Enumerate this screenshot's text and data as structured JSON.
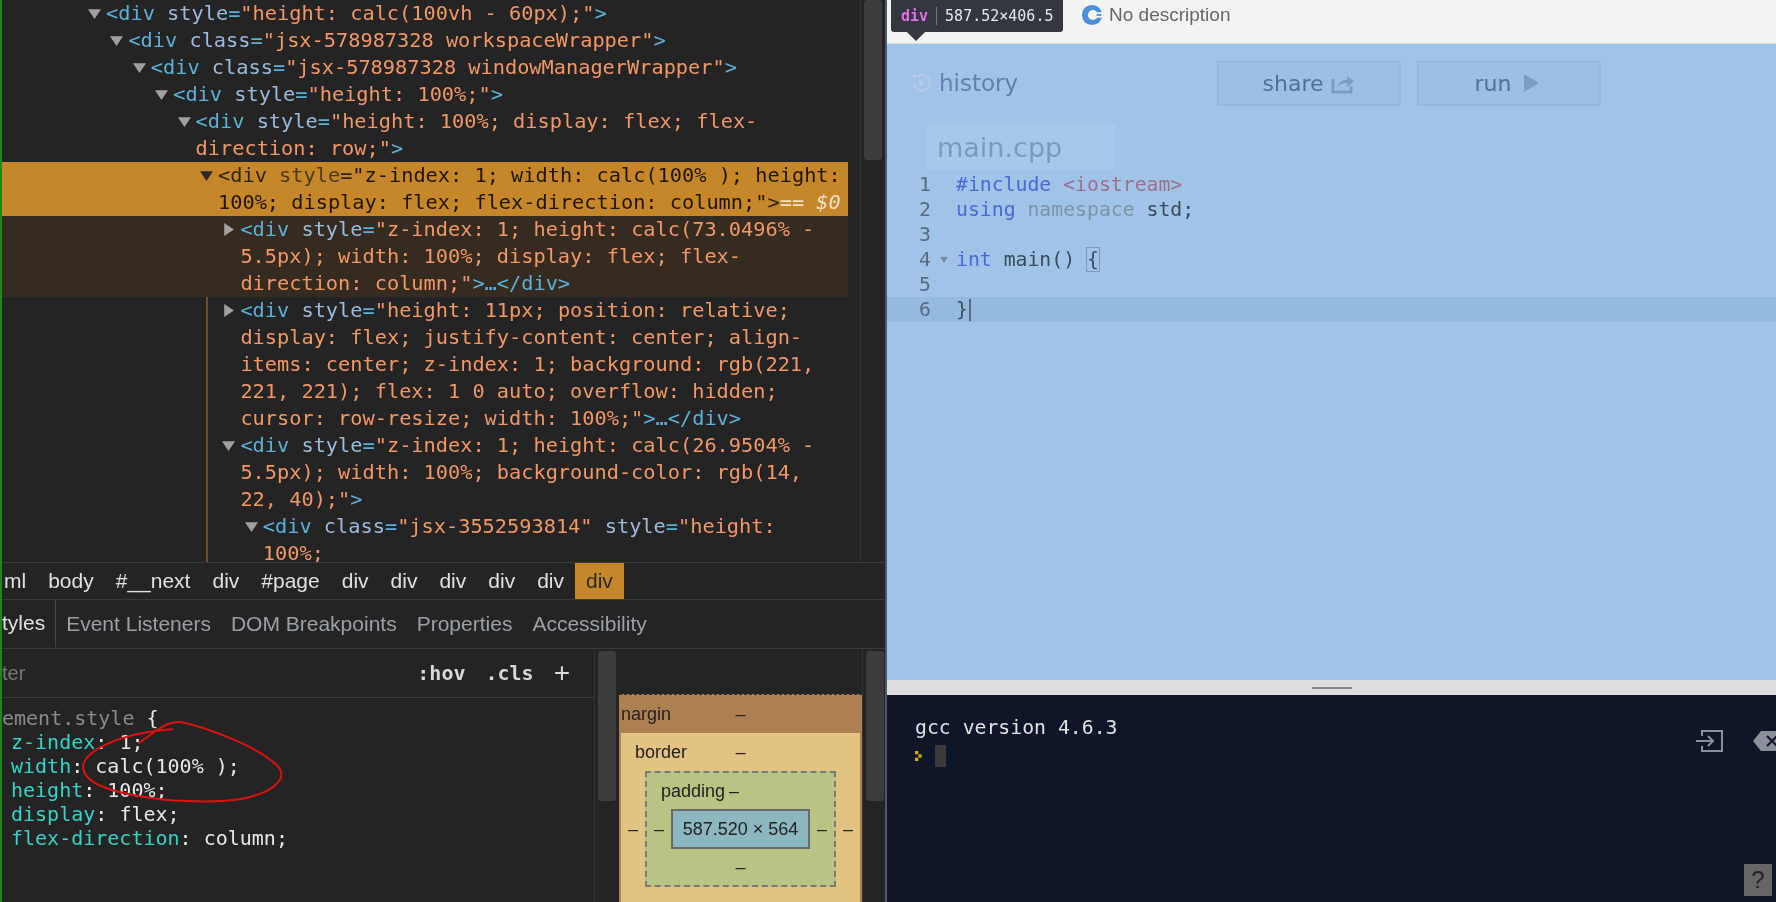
{
  "dom_tree": {
    "selected_suffix": "== $0",
    "nodes": [
      {
        "markup": "<div style=\"height: calc(100vh - 60px);\">",
        "expanded": true,
        "selected": false,
        "hovered": false,
        "children": [
          {
            "markup": "<div class=\"jsx-578987328 workspaceWrapper\">",
            "expanded": true,
            "selected": false,
            "hovered": false,
            "children": [
              {
                "markup": "<div class=\"jsx-578987328 windowManagerWrapper\">",
                "expanded": true,
                "selected": false,
                "hovered": false,
                "children": [
                  {
                    "markup": "<div style=\"height: 100%;\">",
                    "expanded": true,
                    "selected": false,
                    "hovered": false,
                    "children": [
                      {
                        "markup": "<div style=\"height: 100%; display: flex; flex-direction: row;\">",
                        "expanded": true,
                        "selected": false,
                        "hovered": false,
                        "children": [
                          {
                            "markup": "<div style=\"z-index: 1; width: calc(100% ); height: 100%; display: flex; flex-direction: column;\">",
                            "expanded": true,
                            "selected": true,
                            "hovered": false,
                            "children": [
                              {
                                "markup": "<div style=\"z-index: 1; height: calc(73.0496% - 5.5px); width: 100%; display: flex; flex-direction: column;\">…</div>",
                                "expanded": false,
                                "selected": false,
                                "hovered": true
                              },
                              {
                                "markup": "<div style=\"height: 11px; position: relative; display: flex; justify-content: center; align-items: center; z-index: 1; background: rgb(221, 221, 221); flex: 1 0 auto; overflow: hidden; cursor: row-resize; width: 100%;\">…</div>",
                                "expanded": false,
                                "selected": false,
                                "hovered": false
                              },
                              {
                                "markup": "<div style=\"z-index: 1; height: calc(26.9504% - 5.5px); width: 100%; background-color: rgb(14, 22, 40);\">",
                                "expanded": true,
                                "selected": false,
                                "hovered": false,
                                "children": [
                                  {
                                    "markup": "<div class=\"jsx-3552593814\" style=\"height: 100%;",
                                    "expanded": true,
                                    "selected": false,
                                    "hovered": false
                                  }
                                ]
                              }
                            ]
                          }
                        ]
                      }
                    ]
                  }
                ]
              }
            ]
          }
        ]
      }
    ]
  },
  "breadcrumbs": [
    {
      "label": "ml",
      "selected": false
    },
    {
      "label": "body",
      "selected": false
    },
    {
      "label": "#__next",
      "selected": false
    },
    {
      "label": "div",
      "selected": false
    },
    {
      "label": "#page",
      "selected": false
    },
    {
      "label": "div",
      "selected": false
    },
    {
      "label": "div",
      "selected": false
    },
    {
      "label": "div",
      "selected": false
    },
    {
      "label": "div",
      "selected": false
    },
    {
      "label": "div",
      "selected": false
    },
    {
      "label": "div",
      "selected": true
    }
  ],
  "panel_tabs": [
    {
      "label": "tyles",
      "selected": true
    },
    {
      "label": "Event Listeners",
      "selected": false
    },
    {
      "label": "DOM Breakpoints",
      "selected": false
    },
    {
      "label": "Properties",
      "selected": false
    },
    {
      "label": "Accessibility",
      "selected": false
    }
  ],
  "styles_filter": {
    "placeholder": "ter",
    "buttons": [
      ":hov",
      ".cls",
      "+"
    ]
  },
  "style_rule": {
    "selector": "ement.style {",
    "declarations": [
      "z-index: 1;",
      "width: calc(100% );",
      "height: 100%;",
      "display: flex;",
      "flex-direction: column;"
    ]
  },
  "box_model": {
    "margin": {
      "label": "nargin",
      "top": "–"
    },
    "border": {
      "label": "border",
      "top": "–",
      "left": "–",
      "right": "–"
    },
    "padding": {
      "label": "padding",
      "top": "–",
      "left": "–",
      "right": "–",
      "bottom": "–"
    },
    "content": "587.520 × 564"
  },
  "element_badge": {
    "tag": "div",
    "size": "587.52×406.5"
  },
  "app_header": {
    "description": "No description"
  },
  "toolbar": {
    "history": "history",
    "buttons": [
      {
        "kind": "share",
        "label": "share"
      },
      {
        "kind": "run",
        "label": "run"
      }
    ]
  },
  "file_tab": {
    "label": "main.cpp"
  },
  "code_lines": [
    {
      "number": "1",
      "foldable": false,
      "active": false,
      "tokens": [
        {
          "kind": "keyword",
          "text": "#include"
        },
        {
          "kind": "string",
          "text": " <iostream>"
        }
      ]
    },
    {
      "number": "2",
      "foldable": false,
      "active": false,
      "tokens": [
        {
          "kind": "keyword",
          "text": "using"
        },
        {
          "kind": "muted",
          "text": " namespace"
        },
        {
          "kind": "plain",
          "text": " std;"
        }
      ]
    },
    {
      "number": "3",
      "foldable": false,
      "active": false
    },
    {
      "number": "4",
      "foldable": true,
      "active": false,
      "tokens": [
        {
          "kind": "keyword",
          "text": "int"
        },
        {
          "kind": "plain",
          "text": " main() "
        },
        {
          "kind": "bracket",
          "text": "{"
        }
      ]
    },
    {
      "number": "5",
      "foldable": false,
      "active": false
    },
    {
      "number": "6",
      "foldable": false,
      "active": true,
      "tokens": [
        {
          "kind": "plain",
          "text": "}"
        }
      ]
    }
  ],
  "terminal": {
    "output": "gcc version 4.6.3",
    "help": "?"
  }
}
